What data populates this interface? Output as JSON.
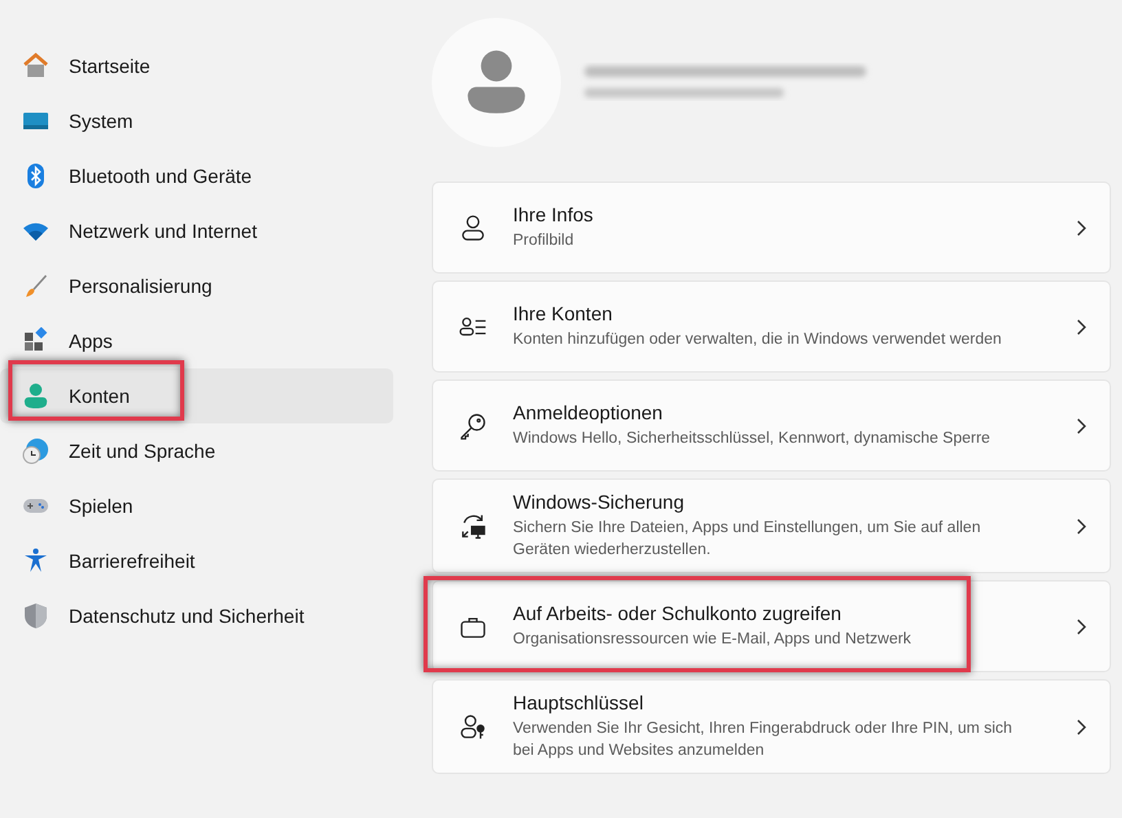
{
  "sidebar": {
    "items": [
      {
        "label": "Startseite",
        "selected": false,
        "highlighted": false
      },
      {
        "label": "System",
        "selected": false,
        "highlighted": false
      },
      {
        "label": "Bluetooth und Geräte",
        "selected": false,
        "highlighted": false
      },
      {
        "label": "Netzwerk und Internet",
        "selected": false,
        "highlighted": false
      },
      {
        "label": "Personalisierung",
        "selected": false,
        "highlighted": false
      },
      {
        "label": "Apps",
        "selected": false,
        "highlighted": false
      },
      {
        "label": "Konten",
        "selected": true,
        "highlighted": true
      },
      {
        "label": "Zeit und Sprache",
        "selected": false,
        "highlighted": false
      },
      {
        "label": "Spielen",
        "selected": false,
        "highlighted": false
      },
      {
        "label": "Barrierefreiheit",
        "selected": false,
        "highlighted": false
      },
      {
        "label": "Datenschutz und Sicherheit",
        "selected": false,
        "highlighted": false
      }
    ]
  },
  "settings": [
    {
      "title": "Ihre Infos",
      "description": "Profilbild",
      "highlighted": false
    },
    {
      "title": "Ihre Konten",
      "description": "Konten hinzufügen oder verwalten, die in Windows verwendet werden",
      "highlighted": false
    },
    {
      "title": "Anmeldeoptionen",
      "description": "Windows Hello, Sicherheitsschlüssel, Kennwort, dynamische Sperre",
      "highlighted": false
    },
    {
      "title": "Windows-Sicherung",
      "description": "Sichern Sie Ihre Dateien, Apps und Einstellungen, um Sie auf allen Geräten wiederherzustellen.",
      "highlighted": false
    },
    {
      "title": "Auf Arbeits- oder Schulkonto zugreifen",
      "description": "Organisationsressourcen wie E-Mail, Apps und Netzwerk",
      "highlighted": true
    },
    {
      "title": "Hauptschlüssel",
      "description": "Verwenden Sie Ihr Gesicht, Ihren Fingerabdruck oder Ihre PIN, um sich bei Apps und Websites anzumelden",
      "highlighted": false
    }
  ]
}
